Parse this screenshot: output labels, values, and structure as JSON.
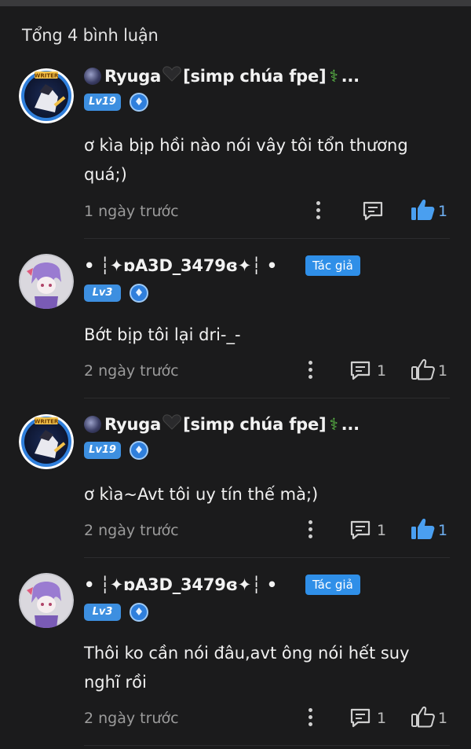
{
  "header": {
    "title": "Tổng 4 bình luận"
  },
  "comments": [
    {
      "username": "Ryuga",
      "username_rest": "[simp chúa fpe]",
      "level": "Lv19",
      "text_lines": [
        "ơ kìa bịp hồi nào nói vây tôi tổn thương",
        "quá;)"
      ],
      "time": "1 ngày trước",
      "reply_count": "",
      "like_count": "1",
      "liked": true,
      "is_author": false
    },
    {
      "username": "• ┆✦ɒA3D_3479ɞ✦┆ •",
      "author_badge": "Tác giả",
      "level": "Lv3",
      "text_lines": [
        "Bớt bịp tôi lại dri-_-"
      ],
      "time": "2 ngày trước",
      "reply_count": "1",
      "like_count": "1",
      "liked": false,
      "is_author": true
    },
    {
      "username": "Ryuga",
      "username_rest": "[simp chúa fpe]",
      "level": "Lv19",
      "text_lines": [
        "ơ kìa~Avt tôi uy tín thế mà;)"
      ],
      "time": "2 ngày trước",
      "reply_count": "1",
      "like_count": "1",
      "liked": true,
      "is_author": false
    },
    {
      "username": "• ┆✦ɒA3D_3479ɞ✦┆ •",
      "author_badge": "Tác giả",
      "level": "Lv3",
      "text_lines": [
        "Thôi ko cần nói đâu,avt ông nói hết suy",
        "nghĩ rồi"
      ],
      "time": "2 ngày trước",
      "reply_count": "1",
      "like_count": "1",
      "liked": false,
      "is_author": true
    }
  ],
  "colors": {
    "accent": "#2f8fe8",
    "background": "#1b1b1c",
    "liked": "#4a9ff0"
  },
  "icons": {
    "more": "more-vertical-icon",
    "reply": "reply-icon",
    "like": "thumbs-up-icon",
    "level_shield": "level-shield-icon"
  }
}
